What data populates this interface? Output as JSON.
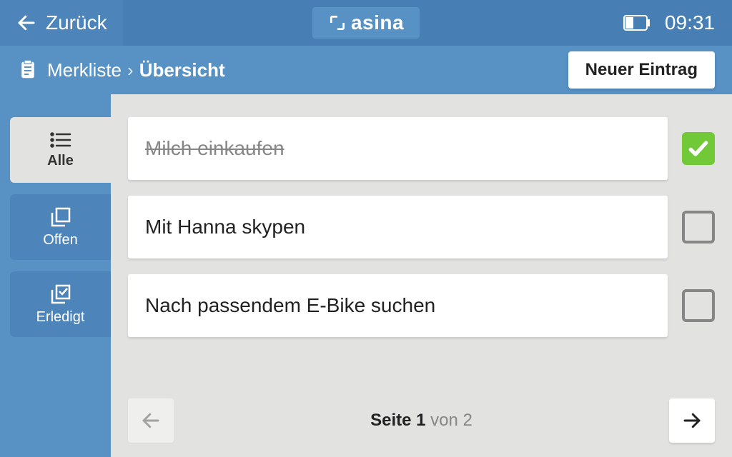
{
  "topbar": {
    "back_label": "Zurück",
    "brand": "asina",
    "clock": "09:31"
  },
  "breadcrumb": {
    "root": "Merkliste",
    "current": "Übersicht",
    "new_label": "Neuer Eintrag"
  },
  "sidebar": {
    "tabs": [
      {
        "label": "Alle",
        "active": true
      },
      {
        "label": "Offen",
        "active": false
      },
      {
        "label": "Erledigt",
        "active": false
      }
    ]
  },
  "items": [
    {
      "title": "Milch einkaufen",
      "done": true
    },
    {
      "title": "Mit Hanna skypen",
      "done": false
    },
    {
      "title": "Nach passendem E-Bike suchen",
      "done": false
    }
  ],
  "pagination": {
    "label_prefix": "Seite ",
    "current": "1",
    "of_word": " von ",
    "total": "2"
  }
}
